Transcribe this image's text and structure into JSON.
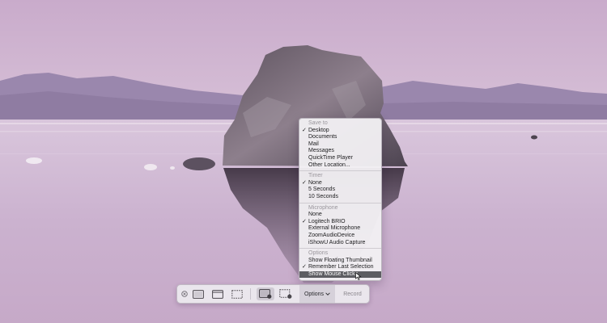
{
  "menu": {
    "sections": [
      {
        "header": "Save to",
        "items": [
          {
            "label": "Desktop",
            "checked": true
          },
          {
            "label": "Documents",
            "checked": false
          },
          {
            "label": "Mail",
            "checked": false
          },
          {
            "label": "Messages",
            "checked": false
          },
          {
            "label": "QuickTime Player",
            "checked": false
          },
          {
            "label": "Other Location...",
            "checked": false
          }
        ]
      },
      {
        "header": "Timer",
        "items": [
          {
            "label": "None",
            "checked": true
          },
          {
            "label": "5 Seconds",
            "checked": false
          },
          {
            "label": "10 Seconds",
            "checked": false
          }
        ]
      },
      {
        "header": "Microphone",
        "items": [
          {
            "label": "None",
            "checked": false
          },
          {
            "label": "Logitech BRIO",
            "checked": true
          },
          {
            "label": "External Microphone",
            "checked": false
          },
          {
            "label": "ZoomAudioDevice",
            "checked": false
          },
          {
            "label": "iShowU Audio Capture",
            "checked": false
          }
        ]
      },
      {
        "header": "Options",
        "items": [
          {
            "label": "Show Floating Thumbnail",
            "checked": false
          },
          {
            "label": "Remember Last Selection",
            "checked": true
          },
          {
            "label": "Show Mouse Clicks",
            "checked": false,
            "highlighted": true
          }
        ]
      }
    ]
  },
  "toolbar": {
    "close_icon": "close-icon",
    "tools": [
      {
        "name": "capture-entire-screen",
        "icon": "screen-icon"
      },
      {
        "name": "capture-selected-window",
        "icon": "window-icon"
      },
      {
        "name": "capture-selected-portion",
        "icon": "dashed-rect-icon"
      },
      {
        "name": "record-entire-screen",
        "icon": "screen-record-icon",
        "selected": true
      },
      {
        "name": "record-selected-portion",
        "icon": "dashed-record-icon"
      }
    ],
    "options_label": "Options",
    "record_label": "Record"
  },
  "colors": {
    "menu_highlight": "#5d5d62",
    "menu_header": "#9a969c",
    "toolbar_bg": "#ece9ee"
  }
}
